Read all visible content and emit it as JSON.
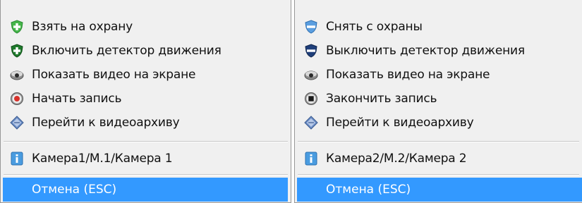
{
  "menus": [
    {
      "items": [
        {
          "label": "Взять на охрану",
          "icon": "shield-plus-light-icon"
        },
        {
          "label": "Включить детектор движения",
          "icon": "shield-plus-dark-icon"
        },
        {
          "label": "Показать видео на экране",
          "icon": "camera-icon"
        },
        {
          "label": "Начать запись",
          "icon": "record-icon"
        },
        {
          "label": "Перейти к видеоархиву",
          "icon": "archive-icon"
        }
      ],
      "camera_label": "Камера1/М.1/Камера 1",
      "cancel_label": "Отмена (ESC)"
    },
    {
      "items": [
        {
          "label": "Снять с охраны",
          "icon": "shield-light-blue-icon"
        },
        {
          "label": "Выключить детектор движения",
          "icon": "shield-dark-blue-icon"
        },
        {
          "label": "Показать видео на экране",
          "icon": "camera-icon"
        },
        {
          "label": "Закончить запись",
          "icon": "stop-icon"
        },
        {
          "label": "Перейти к видеоархиву",
          "icon": "archive-icon"
        }
      ],
      "camera_label": "Камера2/М.2/Камера 2",
      "cancel_label": "Отмена (ESC)"
    }
  ],
  "colors": {
    "highlight": "#3399ff",
    "menu_bg": "#f0f0f0",
    "shield_green": "#3fae3f",
    "shield_dark_green": "#1e6e28",
    "shield_blue": "#4a8fd6",
    "shield_dark_blue": "#1f3f7a"
  }
}
